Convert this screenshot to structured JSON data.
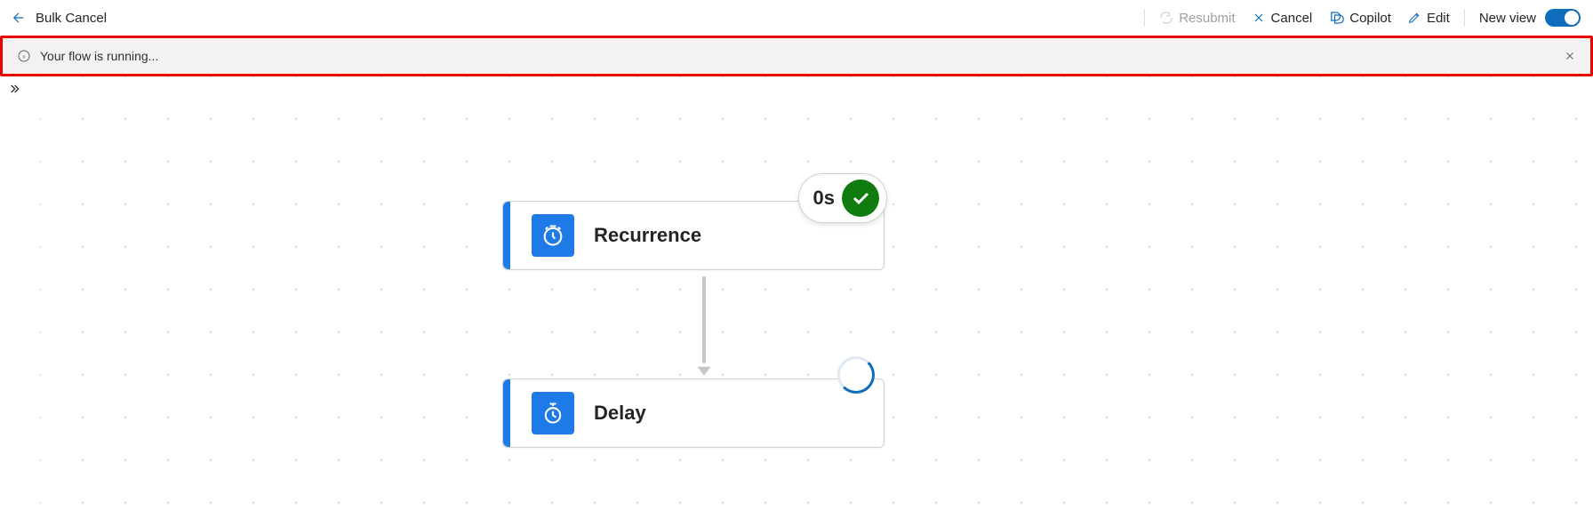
{
  "toolbar": {
    "title": "Bulk Cancel",
    "resubmit": "Resubmit",
    "cancel": "Cancel",
    "copilot": "Copilot",
    "edit": "Edit",
    "new_view": "New view"
  },
  "notification": {
    "message": "Your flow is running..."
  },
  "flow": {
    "node1": {
      "title": "Recurrence",
      "duration": "0s"
    },
    "node2": {
      "title": "Delay"
    }
  }
}
